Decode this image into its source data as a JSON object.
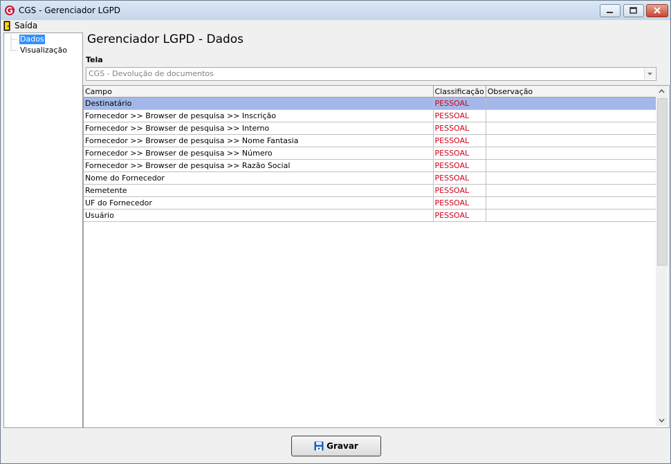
{
  "window": {
    "title": "CGS - Gerenciador LGPD"
  },
  "menu": {
    "exit_label": "Saída"
  },
  "tree": {
    "items": [
      "Dados",
      "Visualização"
    ]
  },
  "page": {
    "title": "Gerenciador LGPD - Dados",
    "tela_label": "Tela"
  },
  "combo": {
    "value": "CGS - Devolução de documentos"
  },
  "grid": {
    "columns": [
      "Campo",
      "Classificação",
      "Observação"
    ],
    "rows": [
      {
        "campo": "Destinatário",
        "classificacao": "PESSOAL",
        "observacao": ""
      },
      {
        "campo": "Fornecedor >> Browser de pesquisa >> Inscrição",
        "classificacao": "PESSOAL",
        "observacao": ""
      },
      {
        "campo": "Fornecedor >> Browser de pesquisa >> Interno",
        "classificacao": "PESSOAL",
        "observacao": ""
      },
      {
        "campo": "Fornecedor >> Browser de pesquisa >> Nome Fantasia",
        "classificacao": "PESSOAL",
        "observacao": ""
      },
      {
        "campo": "Fornecedor >> Browser de pesquisa >> Número",
        "classificacao": "PESSOAL",
        "observacao": ""
      },
      {
        "campo": "Fornecedor >> Browser de pesquisa >> Razão Social",
        "classificacao": "PESSOAL",
        "observacao": ""
      },
      {
        "campo": "Nome do Fornecedor",
        "classificacao": "PESSOAL",
        "observacao": ""
      },
      {
        "campo": "Remetente",
        "classificacao": "PESSOAL",
        "observacao": ""
      },
      {
        "campo": "UF do Fornecedor",
        "classificacao": "PESSOAL",
        "observacao": ""
      },
      {
        "campo": "Usuário",
        "classificacao": "PESSOAL",
        "observacao": ""
      }
    ]
  },
  "buttons": {
    "save_label": "Gravar"
  },
  "colors": {
    "selected_row": "#a3b8e8",
    "classification_text": "#d0021b",
    "tree_selection": "#3390ff"
  }
}
